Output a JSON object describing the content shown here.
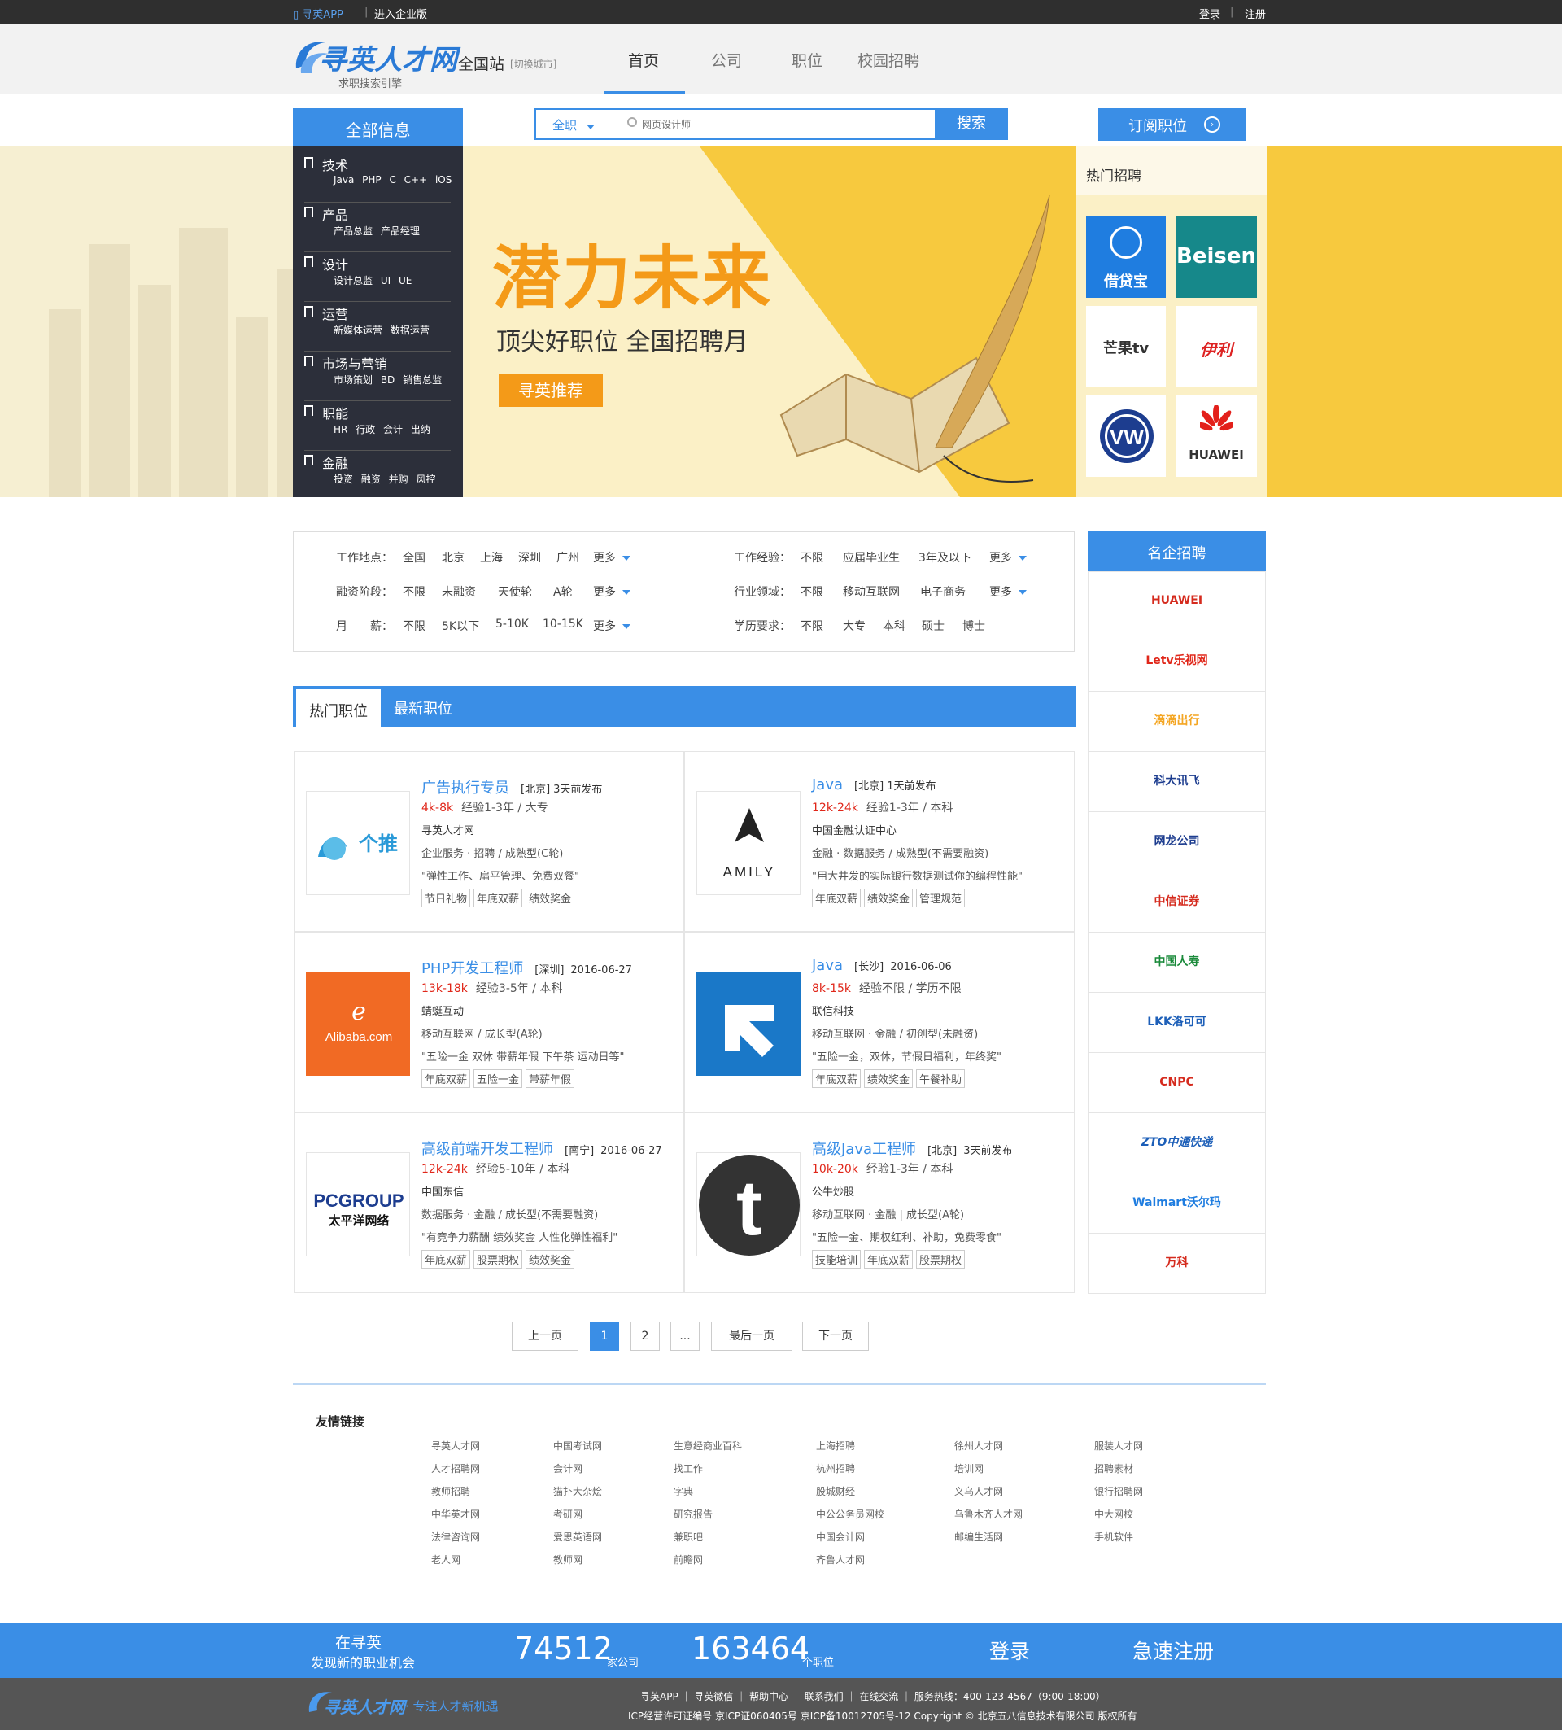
{
  "topbar": {
    "app": "寻英APP",
    "enterprise": "进入企业版",
    "login": "登录",
    "register": "注册"
  },
  "header": {
    "logo": "寻英人才网",
    "slogan": "求职搜索引擎",
    "site": "全国站",
    "switch_city": "[切换城市]",
    "nav": [
      "首页",
      "公司",
      "职位",
      "校园招聘"
    ]
  },
  "search": {
    "all_info": "全部信息",
    "type": "全职",
    "placeholder": "网页设计师",
    "button": "搜索",
    "subscribe": "订阅职位"
  },
  "categories": [
    {
      "title": "技术",
      "subs": "Java PHP C C++ iOS"
    },
    {
      "title": "产品",
      "subs": "产品总监 产品经理"
    },
    {
      "title": "设计",
      "subs": "设计总监 UI UE"
    },
    {
      "title": "运营",
      "subs": "新媒体运营 数据运营"
    },
    {
      "title": "市场与营销",
      "subs": "市场策划 BD 销售总监"
    },
    {
      "title": "职能",
      "subs": "HR 行政 会计 出纳"
    },
    {
      "title": "金融",
      "subs": "投资 融资 并购 风控"
    }
  ],
  "banner": {
    "headline": "潜力未来",
    "subline": "顶尖好职位 全国招聘月",
    "button": "寻英推荐",
    "hot_title": "热门招聘",
    "hot_companies": [
      "借贷宝",
      "Beisen",
      "芒果tv",
      "伊利",
      "VW",
      "HUAWEI"
    ]
  },
  "filters": {
    "location": {
      "label": "工作地点：",
      "options": [
        "全国",
        "北京",
        "上海",
        "深圳",
        "广州"
      ],
      "more": "更多"
    },
    "funding": {
      "label": "融资阶段：",
      "options": [
        "不限",
        "未融资",
        "天使轮",
        "A轮"
      ],
      "more": "更多"
    },
    "salary": {
      "label": "月　　薪：",
      "options": [
        "不限",
        "5K以下",
        "5-10K",
        "10-15K"
      ],
      "more": "更多"
    },
    "experience": {
      "label": "工作经验：",
      "options": [
        "不限",
        "应届毕业生",
        "3年及以下"
      ],
      "more": "更多"
    },
    "industry": {
      "label": "行业领域：",
      "options": [
        "不限",
        "移动互联网",
        "电子商务"
      ],
      "more": "更多"
    },
    "education": {
      "label": "学历要求：",
      "options": [
        "不限",
        "大专",
        "本科",
        "硕士",
        "博士"
      ]
    }
  },
  "tabs": [
    "热门职位",
    "最新职位"
  ],
  "jobs": [
    {
      "title": "广告执行专员",
      "city": "[北京]",
      "time": "3天前发布",
      "salary": "4k-8k",
      "req": "经验1-3年 / 大专",
      "company": "寻英人才网",
      "industry": "企业服务 · 招聘 / 成熟型(C轮)",
      "quote": "\"弹性工作、扁平管理、免费双餐\"",
      "tags": [
        "节日礼物",
        "年底双薪",
        "绩效奖金"
      ],
      "logo": "个推"
    },
    {
      "title": "Java",
      "city": "[北京]",
      "time": "1天前发布",
      "salary": "12k-24k",
      "req": "经验1-3年 / 本科",
      "company": "中国金融认证中心",
      "industry": "金融 · 数据服务 / 成熟型(不需要融资)",
      "quote": "\"用大井发的实际银行数据测试你的编程性能\"",
      "tags": [
        "年底双薪",
        "绩效奖金",
        "管理规范"
      ],
      "logo": "AMILY"
    },
    {
      "title": "PHP开发工程师",
      "city": "[深圳]",
      "time": "2016-06-27",
      "salary": "13k-18k",
      "req": "经验3-5年 / 本科",
      "company": "蜻蜓互动",
      "industry": "移动互联网 / 成长型(A轮)",
      "quote": "\"五险一金 双休 带薪年假 下午茶 运动日等\"",
      "tags": [
        "年底双薪",
        "五险一金",
        "带薪年假"
      ],
      "logo": "Alibaba.com"
    },
    {
      "title": "Java",
      "city": "[长沙]",
      "time": "2016-06-06",
      "salary": "8k-15k",
      "req": "经验不限 / 学历不限",
      "company": "联信科技",
      "industry": "移动互联网 · 金融 / 初创型(未融资)",
      "quote": "\"五险一金，双休，节假日福利，年终奖\"",
      "tags": [
        "年底双薪",
        "绩效奖金",
        "午餐补助"
      ],
      "logo": "arrow"
    },
    {
      "title": "高级前端开发工程师",
      "city": "[南宁]",
      "time": "2016-06-27",
      "salary": "12k-24k",
      "req": "经验5-10年 / 本科",
      "company": "中国东信",
      "industry": "数据服务 · 金融 / 成长型(不需要融资)",
      "quote": "\"有竞争力薪酬 绩效奖金 人性化弹性福利\"",
      "tags": [
        "年底双薪",
        "股票期权",
        "绩效奖金"
      ],
      "logo": "PCGROUP"
    },
    {
      "title": "高级Java工程师",
      "city": "[北京]",
      "time": "3天前发布",
      "salary": "10k-20k",
      "req": "经验1-3年 / 本科",
      "company": "公牛炒股",
      "industry": "移动互联网 · 金融 | 成长型(A轮)",
      "quote": "\"五险一金、期权红利、补助，免费零食\"",
      "tags": [
        "技能培训",
        "年底双薪",
        "股票期权"
      ],
      "logo": "t"
    }
  ],
  "famous": {
    "title": "名企招聘",
    "companies": [
      "HUAWEI",
      "Letv乐视网",
      "滴滴出行",
      "科大讯飞",
      "网龙公司",
      "中信证券",
      "中国人寿",
      "LKK洛可可",
      "CNPC",
      "ZTO中通快递",
      "Walmart沃尔玛",
      "万科"
    ]
  },
  "pagination": {
    "prev": "上一页",
    "pages": [
      "1",
      "2",
      "..."
    ],
    "last": "最后一页",
    "next": "下一页"
  },
  "links": {
    "title": "友情链接",
    "columns": [
      [
        "寻英人才网",
        "人才招聘网",
        "教师招聘",
        "中华英才网",
        "法律咨询网",
        "老人网"
      ],
      [
        "中国考试网",
        "会计网",
        "猫扑大杂烩",
        "考研网",
        "爱思英语网",
        "教师网"
      ],
      [
        "生意经商业百科",
        "找工作",
        "字典",
        "研究报告",
        "兼职吧",
        "前瞻网"
      ],
      [
        "上海招聘",
        "杭州招聘",
        "股城财经",
        "中公公务员网校",
        "中国会计网",
        "齐鲁人才网"
      ],
      [
        "徐州人才网",
        "培训网",
        "义乌人才网",
        "乌鲁木齐人才网",
        "邮编生活网"
      ],
      [
        "服装人才网",
        "招聘素材",
        "银行招聘网",
        "中大网校",
        "手机软件"
      ]
    ]
  },
  "stats": {
    "line1": "在寻英",
    "line2": "发现新的职业机会",
    "companies": "74512",
    "companies_unit": "家公司",
    "jobs": "163464",
    "jobs_unit": "个职位",
    "login": "登录",
    "register": "急速注册"
  },
  "footer": {
    "logo": "寻英人才网",
    "tagline": "· 专注人才新机遇",
    "links": "寻英APP ｜ 寻英微信 ｜ 帮助中心 ｜ 联系我们 ｜ 在线交流 ｜ 服务热线：400-123-4567（9:00-18:00）",
    "icp": "ICP经营许可证编号 京ICP证060405号 京ICP备10012705号-12 Copyright © 北京五八信息技术有限公司 版权所有"
  }
}
